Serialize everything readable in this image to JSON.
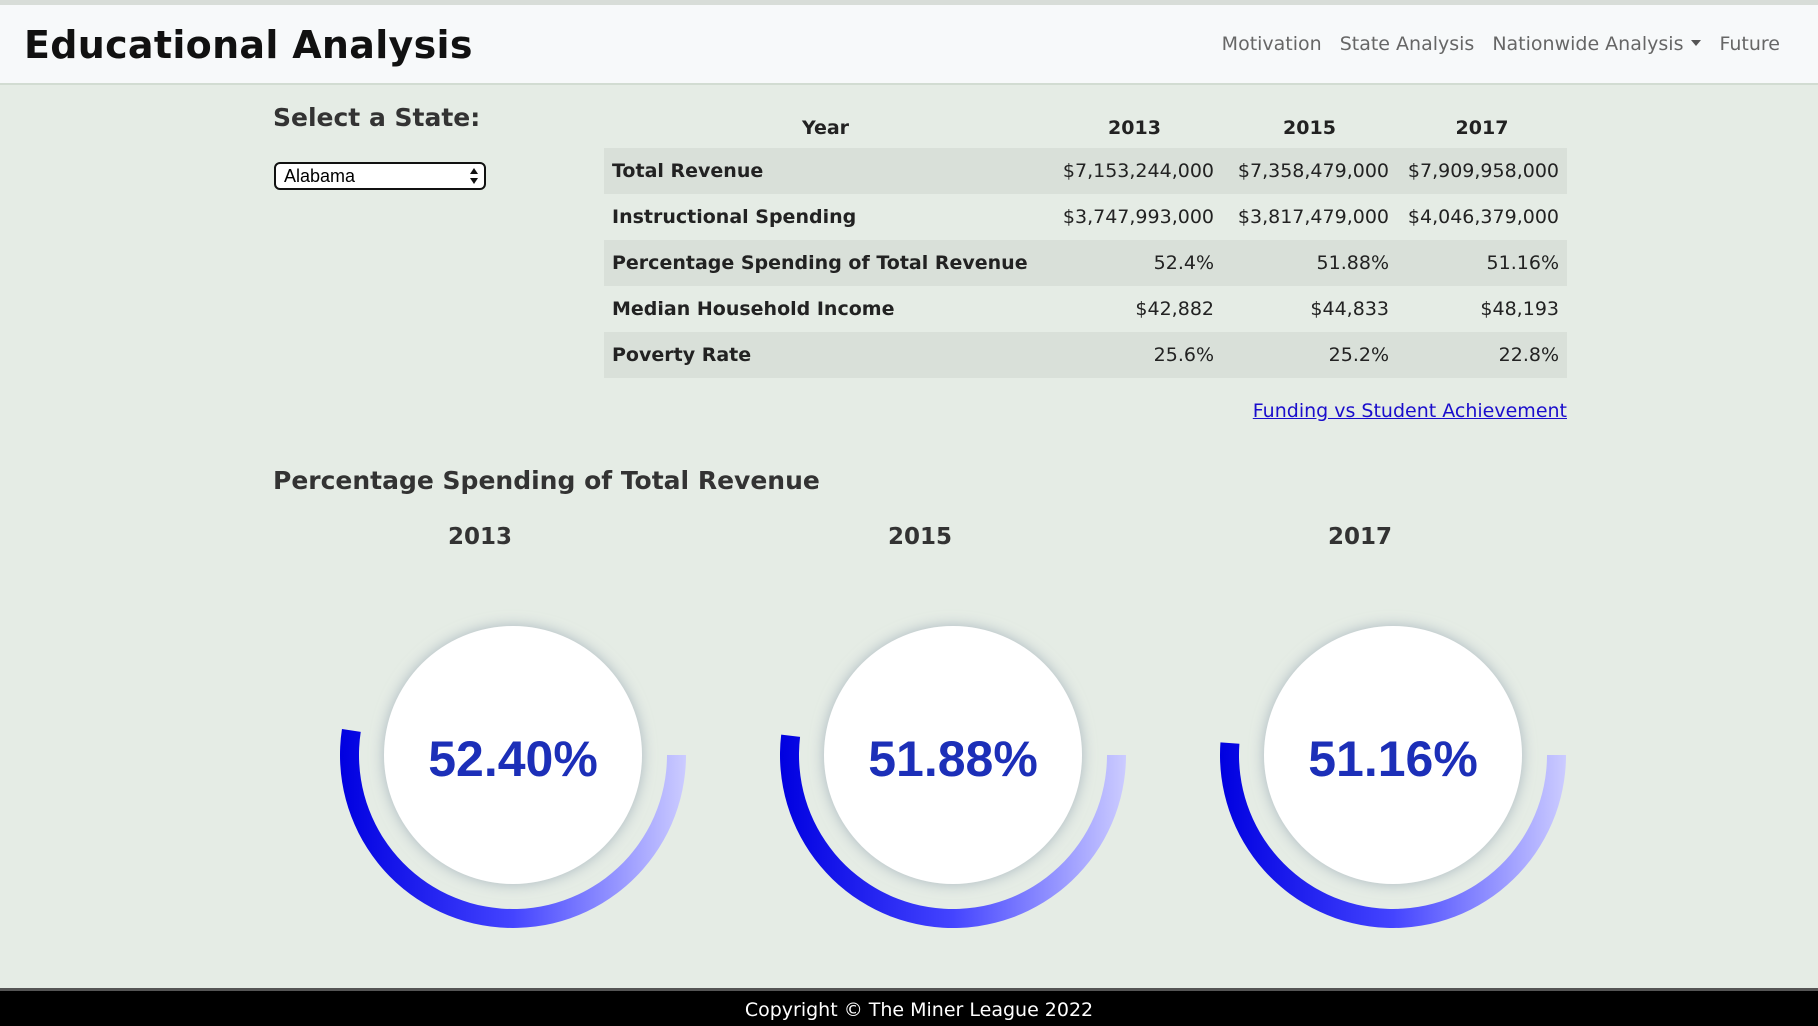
{
  "header": {
    "title": "Educational Analysis",
    "nav": [
      "Motivation",
      "State Analysis",
      "Nationwide Analysis",
      "Future"
    ]
  },
  "state_selector": {
    "label": "Select a State:",
    "selected": "Alabama"
  },
  "table": {
    "header": [
      "Year",
      "2013",
      "2015",
      "2017"
    ],
    "rows": [
      {
        "label": "Total Revenue",
        "values": [
          "$7,153,244,000",
          "$7,358,479,000",
          "$7,909,958,000"
        ]
      },
      {
        "label": "Instructional Spending",
        "values": [
          "$3,747,993,000",
          "$3,817,479,000",
          "$4,046,379,000"
        ]
      },
      {
        "label": "Percentage Spending of Total Revenue",
        "values": [
          "52.4%",
          "51.88%",
          "51.16%"
        ]
      },
      {
        "label": "Median Household Income",
        "values": [
          "$42,882",
          "$44,833",
          "$48,193"
        ]
      },
      {
        "label": "Poverty Rate",
        "values": [
          "25.6%",
          "25.2%",
          "22.8%"
        ]
      }
    ]
  },
  "link": "Funding vs Student Achievement",
  "gauges": {
    "title": "Percentage Spending of Total Revenue",
    "items": [
      {
        "year": "2013",
        "value": 52.4,
        "label": "52.40%"
      },
      {
        "year": "2015",
        "value": 51.88,
        "label": "51.88%"
      },
      {
        "year": "2017",
        "value": 51.16,
        "label": "51.16%"
      }
    ],
    "colors": {
      "fill_dark": "#0000e0",
      "fill_mid": "#4444ff",
      "fill_light": "#ccccff",
      "value_text": "#1c2fb8"
    }
  },
  "footer": "Copyright © The Miner League 2022"
}
